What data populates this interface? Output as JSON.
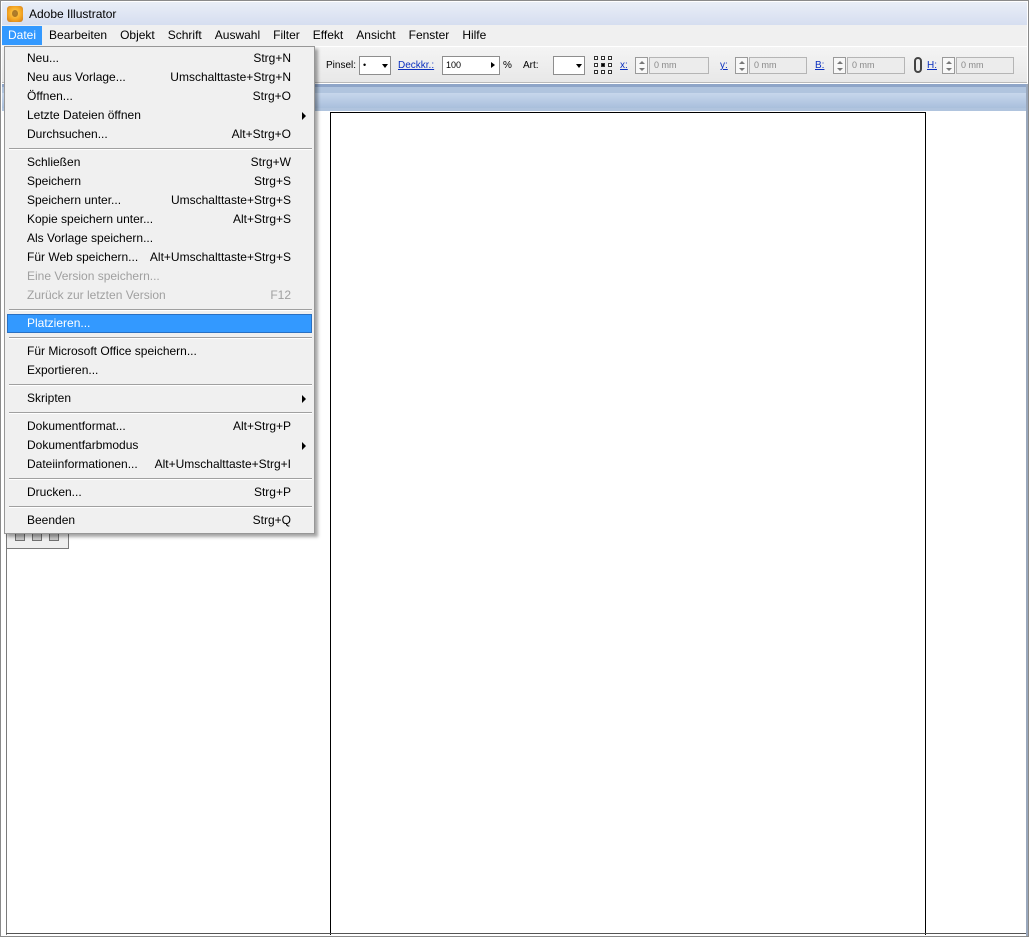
{
  "window": {
    "title": "Adobe Illustrator"
  },
  "menubar": [
    "Datei",
    "Bearbeiten",
    "Objekt",
    "Schrift",
    "Auswahl",
    "Filter",
    "Effekt",
    "Ansicht",
    "Fenster",
    "Hilfe"
  ],
  "controlbar": {
    "pinsel_label": "Pinsel:",
    "pinsel_value": "•",
    "deckkr_label": "Deckkr.:",
    "deckkr_value": "100",
    "percent": "%",
    "art_label": "Art:",
    "x_label": "x:",
    "x_value": "0 mm",
    "y_label": "y:",
    "y_value": "0 mm",
    "b_label": "B:",
    "b_value": "0 mm",
    "h_label": "H:",
    "h_value": "0 mm"
  },
  "file_menu": {
    "items": [
      {
        "label": "Neu...",
        "shortcut": "Strg+N"
      },
      {
        "label": "Neu aus Vorlage...",
        "shortcut": "Umschalttaste+Strg+N"
      },
      {
        "label": "Öffnen...",
        "shortcut": "Strg+O"
      },
      {
        "label": "Letzte Dateien öffnen",
        "shortcut": ""
      },
      {
        "label": "Durchsuchen...",
        "shortcut": "Alt+Strg+O"
      },
      {
        "label": "Schließen",
        "shortcut": "Strg+W"
      },
      {
        "label": "Speichern",
        "shortcut": "Strg+S"
      },
      {
        "label": "Speichern unter...",
        "shortcut": "Umschalttaste+Strg+S"
      },
      {
        "label": "Kopie speichern unter...",
        "shortcut": "Alt+Strg+S"
      },
      {
        "label": "Als Vorlage speichern...",
        "shortcut": ""
      },
      {
        "label": "Für Web speichern...",
        "shortcut": "Alt+Umschalttaste+Strg+S"
      },
      {
        "label": "Eine Version speichern...",
        "shortcut": ""
      },
      {
        "label": "Zurück zur letzten Version",
        "shortcut": "F12"
      },
      {
        "label": "Platzieren...",
        "shortcut": ""
      },
      {
        "label": "Für Microsoft Office speichern...",
        "shortcut": ""
      },
      {
        "label": "Exportieren...",
        "shortcut": ""
      },
      {
        "label": "Skripten",
        "shortcut": ""
      },
      {
        "label": "Dokumentformat...",
        "shortcut": "Alt+Strg+P"
      },
      {
        "label": "Dokumentfarbmodus",
        "shortcut": ""
      },
      {
        "label": "Dateiinformationen...",
        "shortcut": "Alt+Umschalttaste+Strg+I"
      },
      {
        "label": "Drucken...",
        "shortcut": "Strg+P"
      },
      {
        "label": "Beenden",
        "shortcut": "Strg+Q"
      }
    ]
  },
  "colors": {
    "highlight": "#3399ff",
    "menu_bg": "#f0f0f0",
    "link": "#0a2fbf"
  }
}
